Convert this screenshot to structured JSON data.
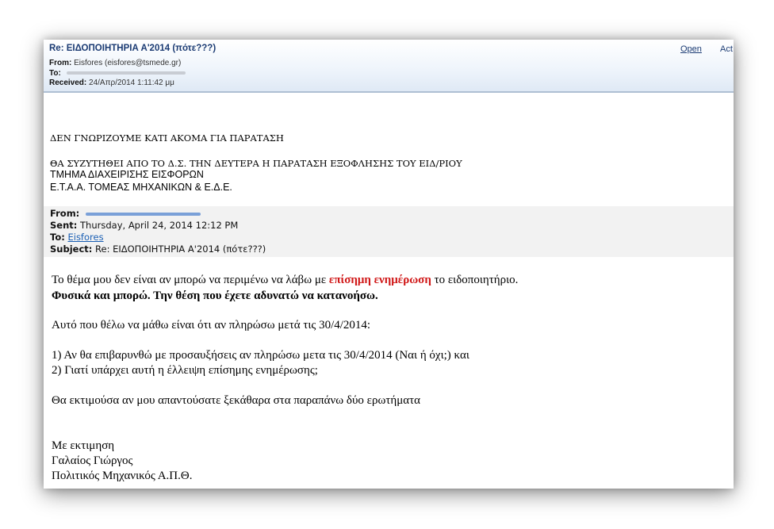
{
  "header": {
    "subject": "Re: ΕΙΔΟΠΟΙΗΤΗΡΙΑ Α'2014 (πότε???)",
    "from_label": "From:",
    "from_value": "Eisfores (eisfores@tsmede.gr)",
    "to_label": "To:",
    "received_label": "Received:",
    "received_value": "24/Απρ/2014 1:11:42 μμ",
    "open_label": "Open",
    "actions_label": "Act"
  },
  "reply": {
    "line1": "ΔΕΝ ΓΝΩΡΙΖΟΥΜΕ ΚΑΤΙ ΑΚΟΜΑ ΓΙΑ ΠΑΡΑΤΑΣΗ",
    "line2": "ΘΑ ΣΥΖΥΤΗΘΕΙ ΑΠΟ ΤΟ Δ.Σ. ΤΗΝ ΔΕΥΤΕΡΑ Η ΠΑΡΑΤΑΣΗ  ΕΞΟΦΛΗΣΗΣ ΤΟΥ ΕΙΔ/ΡΙΟΥ",
    "signature1": "ΤΜΗΜΑ ΔΙΑΧΕΙΡΙΣΗΣ ΕΙΣΦΟΡΩΝ",
    "signature2": "Ε.Τ.Α.Α.   ΤΟΜΕΑΣ ΜΗΧΑΝΙΚΩΝ  & Ε.Δ.Ε."
  },
  "quoted": {
    "from_label": "From:",
    "sent_label": "Sent:",
    "sent_value": "Thursday, April 24, 2014 12:12 PM",
    "to_label": "To:",
    "to_value": "Eisfores",
    "subject_label": "Subject:",
    "subject_value": "Re: ΕΙΔΟΠΟΙΗΤΗΡΙΑ Α'2014 (πότε???)"
  },
  "message": {
    "p1_before": "Το θέμα μου δεν είναι αν μπορώ να περιμένω να λάβω με ",
    "p1_emph": "επίσημη ενημέρωση",
    "p1_after": " το ειδοποιητήριο.",
    "p2": "Φυσικά και μπορώ. Την θέση που έχετε αδυνατώ να κατανοήσω.",
    "p3": "Αυτό που θέλω να μάθω είναι ότι αν πληρώσω μετά τις 30/4/2014:",
    "q1": "1) Αν θα επιβαρυνθώ με προσαυξήσεις αν πληρώσω μετα τις 30/4/2014 (Ναι ή όχι;)  και",
    "q2": "2) Γιατί υπάρχει αυτή η έλλειψη επίσημης ενημέρωσης;",
    "p4": "Θα εκτιμούσα αν μου απαντούσατε ξεκάθαρα στα παραπάνω δύο ερωτήματα",
    "closing1": "Με εκτιμηση",
    "closing2": "Γαλαίος Γιώργος",
    "closing3": "Πολιτικός Μηχανικός Α.Π.Θ."
  }
}
